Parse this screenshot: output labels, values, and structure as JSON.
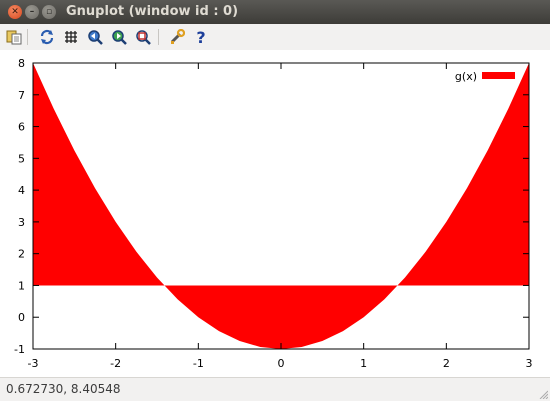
{
  "window": {
    "title": "Gnuplot (window id : 0)"
  },
  "toolbar": {
    "buttons": [
      {
        "name": "copy-to-clipboard-icon"
      },
      {
        "name": "replot-icon"
      },
      {
        "name": "toggle-grid-icon"
      },
      {
        "name": "zoom-previous-icon"
      },
      {
        "name": "zoom-next-icon"
      },
      {
        "name": "unzoom-icon"
      },
      {
        "name": "preferences-icon"
      },
      {
        "name": "help-icon",
        "label": "?"
      }
    ]
  },
  "chart_data": {
    "type": "area",
    "title": "",
    "xlabel": "",
    "ylabel": "",
    "xlim": [
      -3,
      3
    ],
    "ylim": [
      -1,
      8
    ],
    "xticks": [
      "-3",
      "-2",
      "-1",
      "0",
      "1",
      "2",
      "3"
    ],
    "yticks": [
      "-1",
      "0",
      "1",
      "2",
      "3",
      "4",
      "5",
      "6",
      "7",
      "8"
    ],
    "grid": false,
    "legend_position": "top-right",
    "fill_baseline": 1,
    "series": [
      {
        "name": "g(x)",
        "color": "#ff0000",
        "x": [
          -3,
          -2.75,
          -2.5,
          -2.25,
          -2,
          -1.75,
          -1.5,
          -1.25,
          -1,
          -0.75,
          -0.5,
          -0.25,
          0,
          0.25,
          0.5,
          0.75,
          1,
          1.25,
          1.5,
          1.75,
          2,
          2.25,
          2.5,
          2.75,
          3
        ],
        "y": [
          8,
          6.5625,
          5.25,
          4.0625,
          3,
          2.0625,
          1.25,
          0.5625,
          0,
          -0.4375,
          -0.75,
          -0.9375,
          -1,
          -0.9375,
          -0.75,
          -0.4375,
          0,
          0.5625,
          1.25,
          2.0625,
          3,
          4.0625,
          5.25,
          6.5625,
          8
        ]
      }
    ]
  },
  "status": {
    "coordinates": "0.672730,  8.40548"
  }
}
